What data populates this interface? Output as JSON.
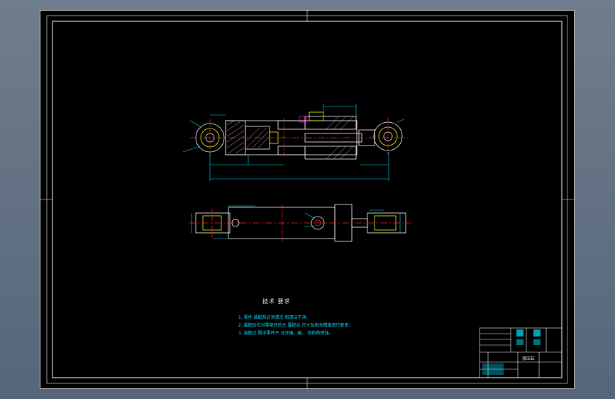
{
  "drawing": {
    "tech_requirements": {
      "title": "技术 要求",
      "lines": [
        "1. 零件 装配前必须清洗 和清洁干净;",
        "2. 装配后应对零部件的主 要配合 尺寸及相关精度进行复查;",
        "3. 装配过 程中零件不 允许磕、碰、 划伤和锈蚀。"
      ]
    },
    "title_block": {
      "label": "液压缸"
    }
  },
  "colors": {
    "background": "#5c6b7c",
    "sheet": "#000000",
    "frame": "#cfcfcf",
    "outline": "#ffffff",
    "hidden": "#ffff00",
    "centerline": "#ff2020",
    "dimension": "#00e5ff",
    "section": "#ff00ff"
  }
}
